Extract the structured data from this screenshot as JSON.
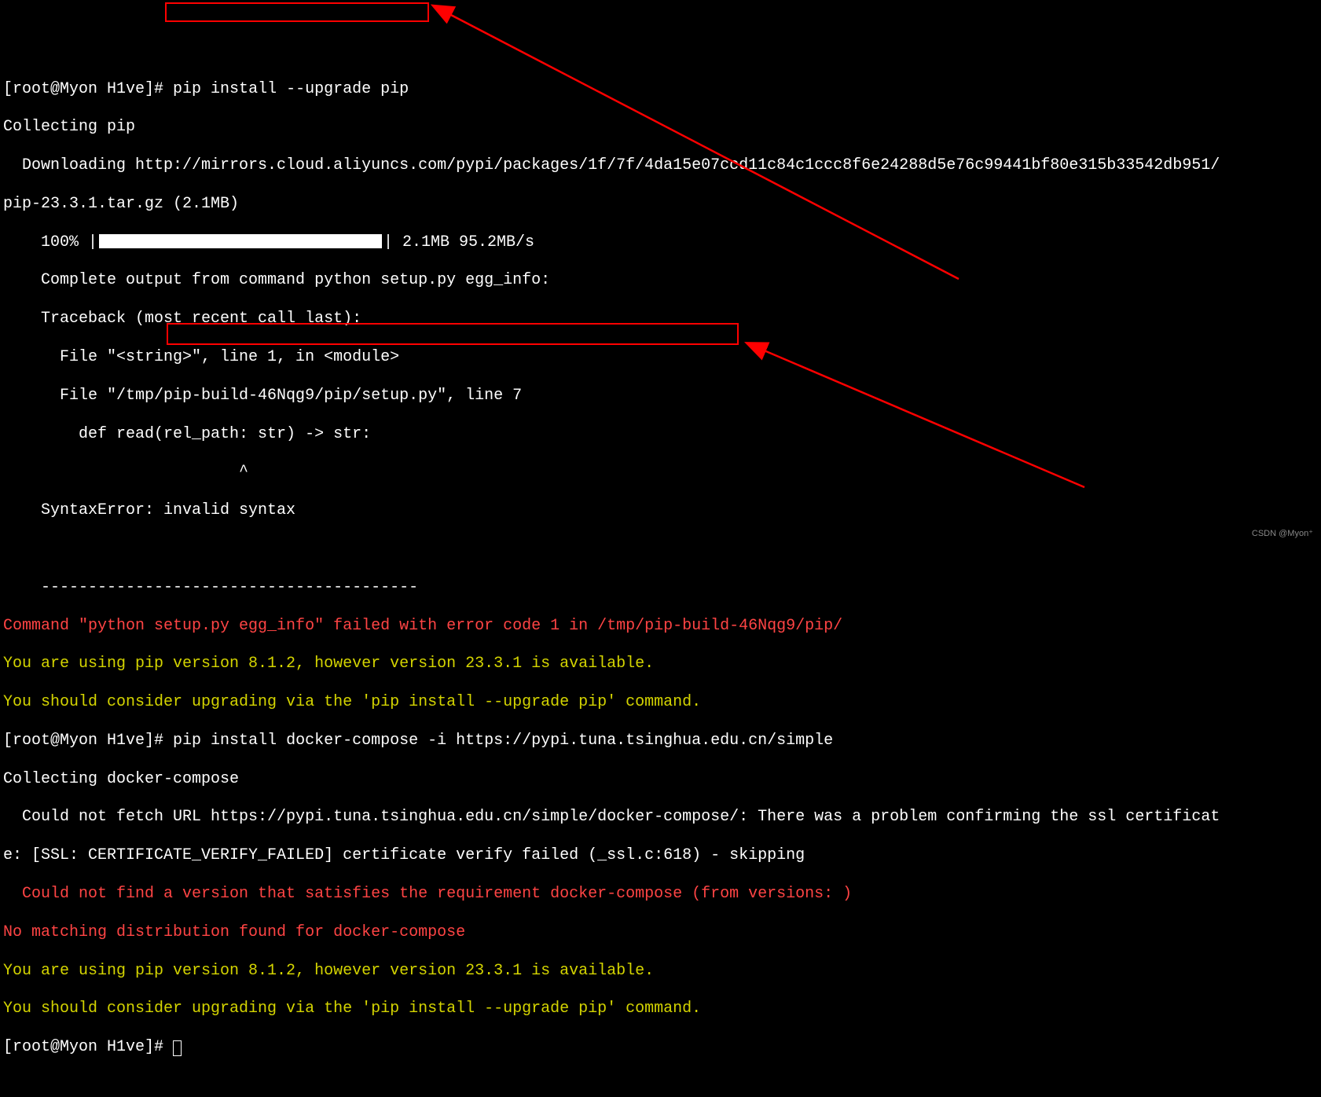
{
  "terminal": {
    "prompt1": "[root@Myon H1ve]# ",
    "cmd1": "pip install --upgrade pip",
    "line2": "Collecting pip",
    "line3": "  Downloading http://mirrors.cloud.aliyuncs.com/pypi/packages/1f/7f/4da15e07ccd11c84c1ccc8f6e24288d5e76c99441bf80e315b33542db951/",
    "line4": "pip-23.3.1.tar.gz (2.1MB)",
    "line5a": "    100% |",
    "line5b": "| 2.1MB 95.2MB/s",
    "line6": "    Complete output from command python setup.py egg_info:",
    "line7": "    Traceback (most recent call last):",
    "line8": "      File \"<string>\", line 1, in <module>",
    "line9": "      File \"/tmp/pip-build-46Nqg9/pip/setup.py\", line 7",
    "line10": "        def read(rel_path: str) -> str:",
    "line11": "                         ^",
    "line12": "    SyntaxError: invalid syntax",
    "line13": "    ",
    "line14": "    ----------------------------------------",
    "err1": "Command \"python setup.py egg_info\" failed with error code 1 in /tmp/pip-build-46Nqg9/pip/",
    "warn1": "You are using pip version 8.1.2, however version 23.3.1 is available.",
    "warn2": "You should consider upgrading via the 'pip install --upgrade pip' command.",
    "prompt2": "[root@Myon H1ve]# ",
    "cmd2": "pip install docker-compose -i https://pypi.tuna.tsinghua.edu.cn/simple",
    "line18": "Collecting docker-compose",
    "line19": "  Could not fetch URL https://pypi.tuna.tsinghua.edu.cn/simple/docker-compose/: There was a problem confirming the ssl certificat",
    "line20": "e: [SSL: CERTIFICATE_VERIFY_FAILED] certificate verify failed (_ssl.c:618) - skipping",
    "err2": "  Could not find a version that satisfies the requirement docker-compose (from versions: )",
    "err3": "No matching distribution found for docker-compose",
    "warn3": "You are using pip version 8.1.2, however version 23.3.1 is available.",
    "warn4": "You should consider upgrading via the 'pip install --upgrade pip' command.",
    "prompt3": "[root@Myon H1ve]# "
  },
  "watermark": "CSDN @Myon⁺"
}
